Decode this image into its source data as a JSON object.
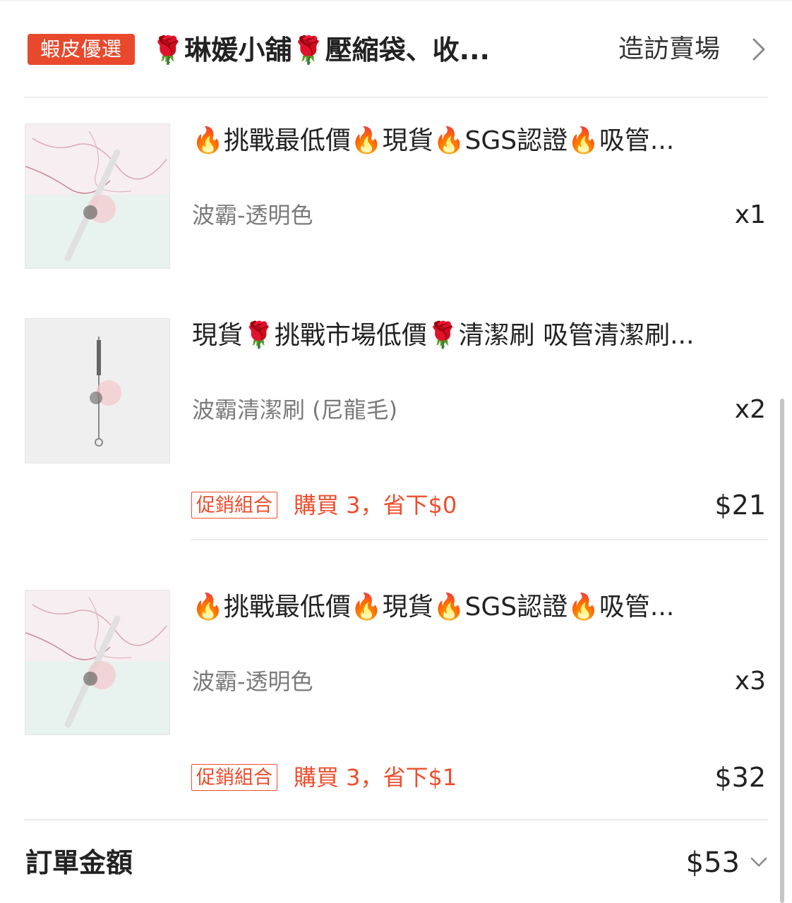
{
  "colors": {
    "accent": "#ee4d2d",
    "badge_bg": "#e8492c",
    "text": "#222222",
    "muted": "#7a7a7a"
  },
  "shop": {
    "badge": "蝦皮優選",
    "name": "🌹琳媛小舖🌹壓縮袋、收...",
    "visit_label": "造訪賣場",
    "visit_icon": "chevron-right-icon"
  },
  "items": [
    {
      "title": "🔥挑戰最低價🔥現貨🔥SGS認證🔥吸管...",
      "variant": "波霸-透明色",
      "quantity": "x1"
    },
    {
      "title": "現貨🌹挑戰市場低價🌹清潔刷 吸管清潔刷...",
      "variant": "波霸清潔刷 (尼龍毛)",
      "quantity": "x2"
    },
    {
      "title": "🔥挑戰最低價🔥現貨🔥SGS認證🔥吸管...",
      "variant": "波霸-透明色",
      "quantity": "x3"
    }
  ],
  "promos": [
    {
      "tag": "促銷組合",
      "text": "購買 3，省下$0",
      "price": "$21"
    },
    {
      "tag": "促銷組合",
      "text": "購買 3，省下$1",
      "price": "$32"
    }
  ],
  "order_total": {
    "label": "訂單金額",
    "value": "$53",
    "icon": "chevron-down-icon"
  }
}
